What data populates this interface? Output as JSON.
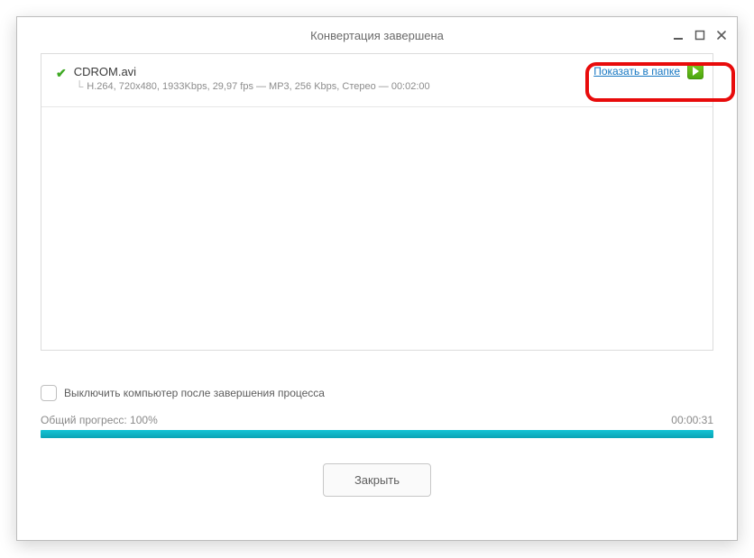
{
  "window": {
    "title": "Конвертация завершена"
  },
  "file": {
    "name": "CDROM.avi",
    "details": "H.264, 720x480, 1933Kbps, 29,97 fps — MP3, 256 Kbps, Стерео — 00:02:00",
    "show_in_folder_label": "Показать в папке"
  },
  "footer": {
    "shutdown_label": "Выключить компьютер после завершения процесса",
    "progress_label": "Общий прогресс: 100%",
    "elapsed": "00:00:31",
    "close_label": "Закрыть"
  }
}
